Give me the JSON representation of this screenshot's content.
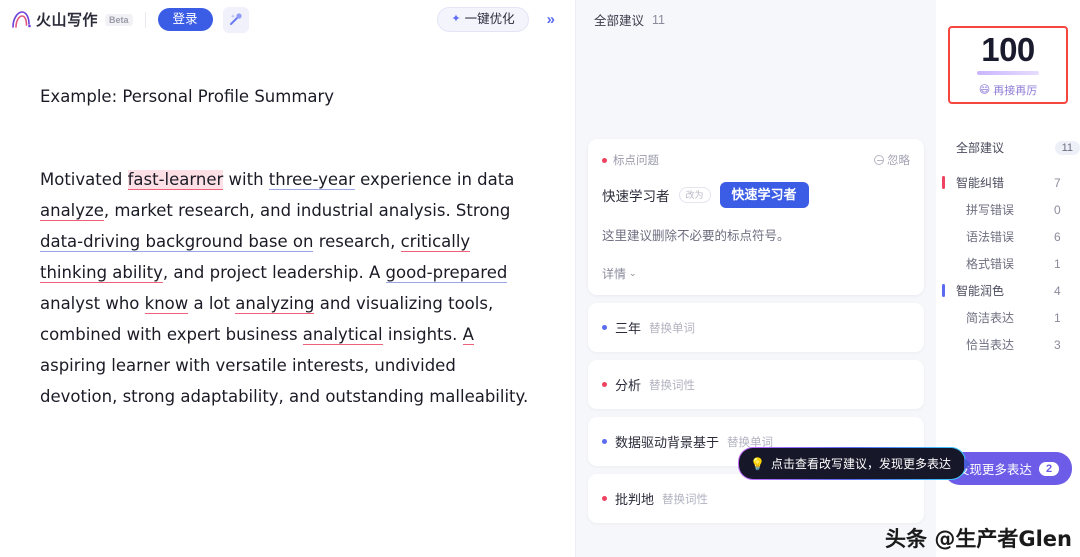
{
  "header": {
    "brand_name": "火山写作",
    "beta_label": "Beta",
    "login_label": "登录",
    "magic_icon": "magic-wand-icon",
    "optimize_label": "一键优化",
    "sparkle_icon": "sparkle-icon",
    "collapse_icon": "»"
  },
  "document": {
    "title": "Example: Personal Profile Summary",
    "paragraph_segments": [
      {
        "text": "Motivated ",
        "mark": "none"
      },
      {
        "text": "fast-learner",
        "mark": "red-highlight"
      },
      {
        "text": " with ",
        "mark": "none"
      },
      {
        "text": "three-year",
        "mark": "blue"
      },
      {
        "text": " experience in data ",
        "mark": "none"
      },
      {
        "text": "analyze",
        "mark": "red"
      },
      {
        "text": ", market research, and industrial analysis. Strong ",
        "mark": "none"
      },
      {
        "text": "data-driving background base on",
        "mark": "blue"
      },
      {
        "text": " research, ",
        "mark": "none"
      },
      {
        "text": "critically thinking ability",
        "mark": "red"
      },
      {
        "text": ", and project leadership. A ",
        "mark": "none"
      },
      {
        "text": "good-prepared",
        "mark": "blue"
      },
      {
        "text": " analyst who ",
        "mark": "none"
      },
      {
        "text": "know",
        "mark": "red"
      },
      {
        "text": " a lot ",
        "mark": "none"
      },
      {
        "text": "analyzing",
        "mark": "red"
      },
      {
        "text": " and visualizing tools, combined with expert business ",
        "mark": "none"
      },
      {
        "text": "analytical",
        "mark": "red"
      },
      {
        "text": " insights. ",
        "mark": "none"
      },
      {
        "text": "A",
        "mark": "red"
      },
      {
        "text": " aspiring learner with versatile interests, undivided devotion, strong adaptability, and outstanding malleability.",
        "mark": "none"
      }
    ]
  },
  "suggestions": {
    "header_title": "全部建议",
    "header_count": "11",
    "active_card": {
      "tag_label": "标点问题",
      "tag_dot": "red",
      "ignore_label": "忽略",
      "ignore_icon": "minus-circle-icon",
      "old_word": "快速学习者",
      "arrow_chip": "改为",
      "new_word": "快速学习者",
      "description": "这里建议删除不必要的标点符号。",
      "more_label": "详情",
      "chevron_icon": "chevron-down-icon"
    },
    "items": [
      {
        "dot": "blue",
        "word": "三年",
        "action": "替换单词"
      },
      {
        "dot": "red",
        "word": "分析",
        "action": "替换词性"
      },
      {
        "dot": "blue",
        "word": "数据驱动背景基于",
        "action": "替换单词"
      },
      {
        "dot": "red",
        "word": "批判地",
        "action": "替换词性"
      }
    ]
  },
  "tooltip": {
    "icon": "lightbulb-icon",
    "text": "点击查看改写建议，发现更多表达"
  },
  "sidebar": {
    "score_value": "100",
    "score_emoji": "😄",
    "score_label": "再接再厉",
    "score_border_color": "#f5453f",
    "categories": [
      {
        "label": "全部建议",
        "count": "11",
        "bar": "none",
        "style": "pill",
        "sub": false
      },
      {
        "label": "智能纠错",
        "count": "7",
        "bar": "red",
        "style": "plain",
        "sub": false
      },
      {
        "label": "拼写错误",
        "count": "0",
        "bar": "none",
        "style": "plain",
        "sub": true
      },
      {
        "label": "语法错误",
        "count": "6",
        "bar": "none",
        "style": "plain",
        "sub": true
      },
      {
        "label": "格式错误",
        "count": "1",
        "bar": "none",
        "style": "plain",
        "sub": true
      },
      {
        "label": "智能润色",
        "count": "4",
        "bar": "blue",
        "style": "plain",
        "sub": false
      },
      {
        "label": "简洁表达",
        "count": "1",
        "bar": "none",
        "style": "plain",
        "sub": true
      },
      {
        "label": "恰当表达",
        "count": "3",
        "bar": "none",
        "style": "plain",
        "sub": true
      }
    ],
    "discover_label": "发现更多表达",
    "discover_count": "2"
  },
  "watermark": {
    "text": "头条 @生产者Glen"
  },
  "colors": {
    "accent_blue": "#3b5ce4",
    "accent_purple": "#6c5ce7",
    "error_red": "#f0435f",
    "highlight_red_bg": "#fde0e5",
    "panel_bg": "#f6f7fb"
  }
}
